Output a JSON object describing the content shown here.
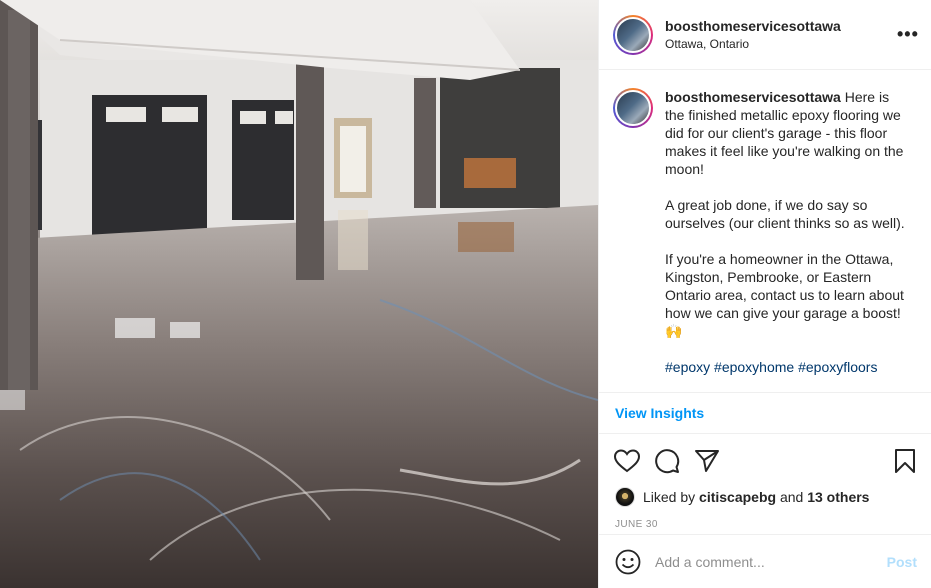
{
  "post": {
    "username": "boosthomeservicesottawa",
    "location": "Ottawa, Ontario",
    "more_label": "•••",
    "caption": {
      "username": "boosthomeservicesottawa",
      "p1": "Here is the finished metallic epoxy flooring we did for our client's garage - this floor makes it feel like you're walking on the moon!",
      "p2": "A great job done, if we do say so ourselves (our client thinks so as well).",
      "p3": "If you're a homeowner in the Ottawa, Kingston, Pembrooke, or Eastern Ontario area, contact us to learn about how we can give your garage a boost! 🙌",
      "tags": "#epoxy #epoxyhome #epoxyfloors"
    },
    "insights_label": "View Insights",
    "likes": {
      "prefix": "Liked by",
      "user": "citiscapebg",
      "joiner": "and",
      "others": "13 others"
    },
    "date": "JUNE 30",
    "comment": {
      "placeholder": "Add a comment...",
      "post_label": "Post"
    }
  },
  "icons": [
    "more-icon",
    "heart-icon",
    "comment-icon",
    "share-icon",
    "bookmark-icon",
    "emoji-icon"
  ],
  "colors": {
    "link_blue": "#0095f6",
    "hashtag": "#00376b",
    "post_disabled": "#b2dffc",
    "meta_gray": "#8e8e8e"
  }
}
